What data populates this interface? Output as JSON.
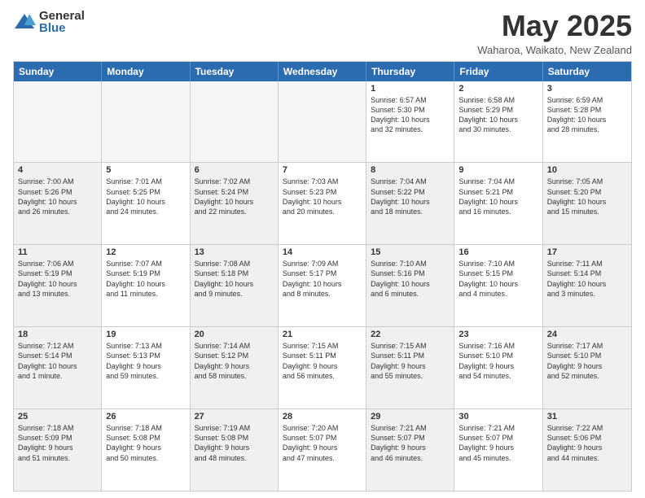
{
  "logo": {
    "general": "General",
    "blue": "Blue"
  },
  "title": "May 2025",
  "location": "Waharoa, Waikato, New Zealand",
  "days": [
    "Sunday",
    "Monday",
    "Tuesday",
    "Wednesday",
    "Thursday",
    "Friday",
    "Saturday"
  ],
  "rows": [
    [
      {
        "num": "",
        "text": "",
        "empty": true
      },
      {
        "num": "",
        "text": "",
        "empty": true
      },
      {
        "num": "",
        "text": "",
        "empty": true
      },
      {
        "num": "",
        "text": "",
        "empty": true
      },
      {
        "num": "1",
        "text": "Sunrise: 6:57 AM\nSunset: 5:30 PM\nDaylight: 10 hours\nand 32 minutes."
      },
      {
        "num": "2",
        "text": "Sunrise: 6:58 AM\nSunset: 5:29 PM\nDaylight: 10 hours\nand 30 minutes."
      },
      {
        "num": "3",
        "text": "Sunrise: 6:59 AM\nSunset: 5:28 PM\nDaylight: 10 hours\nand 28 minutes."
      }
    ],
    [
      {
        "num": "4",
        "text": "Sunrise: 7:00 AM\nSunset: 5:26 PM\nDaylight: 10 hours\nand 26 minutes.",
        "shaded": true
      },
      {
        "num": "5",
        "text": "Sunrise: 7:01 AM\nSunset: 5:25 PM\nDaylight: 10 hours\nand 24 minutes."
      },
      {
        "num": "6",
        "text": "Sunrise: 7:02 AM\nSunset: 5:24 PM\nDaylight: 10 hours\nand 22 minutes.",
        "shaded": true
      },
      {
        "num": "7",
        "text": "Sunrise: 7:03 AM\nSunset: 5:23 PM\nDaylight: 10 hours\nand 20 minutes."
      },
      {
        "num": "8",
        "text": "Sunrise: 7:04 AM\nSunset: 5:22 PM\nDaylight: 10 hours\nand 18 minutes.",
        "shaded": true
      },
      {
        "num": "9",
        "text": "Sunrise: 7:04 AM\nSunset: 5:21 PM\nDaylight: 10 hours\nand 16 minutes."
      },
      {
        "num": "10",
        "text": "Sunrise: 7:05 AM\nSunset: 5:20 PM\nDaylight: 10 hours\nand 15 minutes.",
        "shaded": true
      }
    ],
    [
      {
        "num": "11",
        "text": "Sunrise: 7:06 AM\nSunset: 5:19 PM\nDaylight: 10 hours\nand 13 minutes.",
        "shaded": true
      },
      {
        "num": "12",
        "text": "Sunrise: 7:07 AM\nSunset: 5:19 PM\nDaylight: 10 hours\nand 11 minutes."
      },
      {
        "num": "13",
        "text": "Sunrise: 7:08 AM\nSunset: 5:18 PM\nDaylight: 10 hours\nand 9 minutes.",
        "shaded": true
      },
      {
        "num": "14",
        "text": "Sunrise: 7:09 AM\nSunset: 5:17 PM\nDaylight: 10 hours\nand 8 minutes."
      },
      {
        "num": "15",
        "text": "Sunrise: 7:10 AM\nSunset: 5:16 PM\nDaylight: 10 hours\nand 6 minutes.",
        "shaded": true
      },
      {
        "num": "16",
        "text": "Sunrise: 7:10 AM\nSunset: 5:15 PM\nDaylight: 10 hours\nand 4 minutes."
      },
      {
        "num": "17",
        "text": "Sunrise: 7:11 AM\nSunset: 5:14 PM\nDaylight: 10 hours\nand 3 minutes.",
        "shaded": true
      }
    ],
    [
      {
        "num": "18",
        "text": "Sunrise: 7:12 AM\nSunset: 5:14 PM\nDaylight: 10 hours\nand 1 minute.",
        "shaded": true
      },
      {
        "num": "19",
        "text": "Sunrise: 7:13 AM\nSunset: 5:13 PM\nDaylight: 9 hours\nand 59 minutes."
      },
      {
        "num": "20",
        "text": "Sunrise: 7:14 AM\nSunset: 5:12 PM\nDaylight: 9 hours\nand 58 minutes.",
        "shaded": true
      },
      {
        "num": "21",
        "text": "Sunrise: 7:15 AM\nSunset: 5:11 PM\nDaylight: 9 hours\nand 56 minutes."
      },
      {
        "num": "22",
        "text": "Sunrise: 7:15 AM\nSunset: 5:11 PM\nDaylight: 9 hours\nand 55 minutes.",
        "shaded": true
      },
      {
        "num": "23",
        "text": "Sunrise: 7:16 AM\nSunset: 5:10 PM\nDaylight: 9 hours\nand 54 minutes."
      },
      {
        "num": "24",
        "text": "Sunrise: 7:17 AM\nSunset: 5:10 PM\nDaylight: 9 hours\nand 52 minutes.",
        "shaded": true
      }
    ],
    [
      {
        "num": "25",
        "text": "Sunrise: 7:18 AM\nSunset: 5:09 PM\nDaylight: 9 hours\nand 51 minutes.",
        "shaded": true
      },
      {
        "num": "26",
        "text": "Sunrise: 7:18 AM\nSunset: 5:08 PM\nDaylight: 9 hours\nand 50 minutes."
      },
      {
        "num": "27",
        "text": "Sunrise: 7:19 AM\nSunset: 5:08 PM\nDaylight: 9 hours\nand 48 minutes.",
        "shaded": true
      },
      {
        "num": "28",
        "text": "Sunrise: 7:20 AM\nSunset: 5:07 PM\nDaylight: 9 hours\nand 47 minutes."
      },
      {
        "num": "29",
        "text": "Sunrise: 7:21 AM\nSunset: 5:07 PM\nDaylight: 9 hours\nand 46 minutes.",
        "shaded": true
      },
      {
        "num": "30",
        "text": "Sunrise: 7:21 AM\nSunset: 5:07 PM\nDaylight: 9 hours\nand 45 minutes."
      },
      {
        "num": "31",
        "text": "Sunrise: 7:22 AM\nSunset: 5:06 PM\nDaylight: 9 hours\nand 44 minutes.",
        "shaded": true
      }
    ]
  ]
}
